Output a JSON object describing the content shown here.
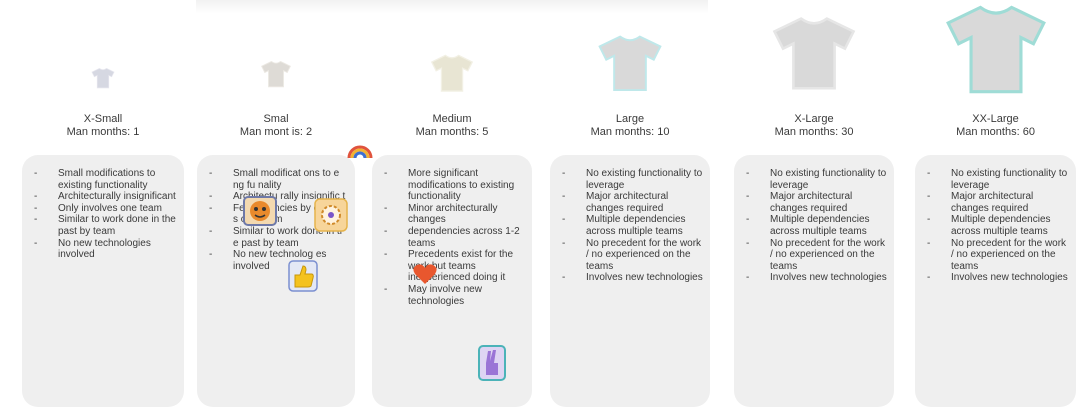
{
  "colors": {
    "card_bg": "#efefef",
    "shirt_gray": "#d9d9d9",
    "shirt_outline_light": "#e3e3e3",
    "shirt_outline_teal": "#bfe8ea",
    "shirt_cream": "#ece8d6"
  },
  "sizes": [
    {
      "title": "X-Small",
      "man_months": "Man months: 1",
      "bullets": [
        "Small modifications to existing functionality",
        "Architecturally insignificant",
        "Only involves one team",
        "Similar to work done in the past by team",
        "No new technologies involved"
      ]
    },
    {
      "title": "Smal",
      "man_months": "Man mont is: 2",
      "bullets": [
        "Small modificat ons to e ng fu nality",
        "Architectu rally insignific t",
        "Few dep ncies by only in s one team",
        "Similar to work done in tl e past by team",
        "No new technolog es involved"
      ]
    },
    {
      "title": "Medium",
      "man_months": "Man months: 5",
      "bullets": [
        "More significant modifications to existing functionality",
        "Minor architecturally changes",
        "dependencies across 1-2 teams",
        "Precedents exist for the work but teams inexperienced doing it",
        "May involve new technologies"
      ]
    },
    {
      "title": "Large",
      "man_months": "Man months: 10",
      "bullets": [
        "No existing functionality to leverage",
        "Major architectural changes required",
        "Multiple dependencies across multiple teams",
        "No precedent for the work / no experienced on the teams",
        "Involves new technologies"
      ]
    },
    {
      "title": "X-Large",
      "man_months": "Man months: 30",
      "bullets": [
        "No existing functionality to leverage",
        "Major architectural changes required",
        "Multiple dependencies across multiple teams",
        "No precedent for the work / no experienced on the teams",
        "Involves new technologies"
      ]
    },
    {
      "title": "XX-Large",
      "man_months": "Man months: 60",
      "bullets": [
        "No existing functionality to leverage",
        "Major architectural changes required",
        "Multiple dependencies across multiple teams",
        "No precedent for the work / no experienced on the teams",
        "Involves new technologies"
      ]
    }
  ],
  "stickers": [
    "rainbow-sticker-icon",
    "party-face-sticker-icon",
    "sparkle-badge-sticker-icon",
    "thumbs-up-sticker-icon",
    "heart-sticker-icon",
    "victory-hand-sticker-icon"
  ]
}
